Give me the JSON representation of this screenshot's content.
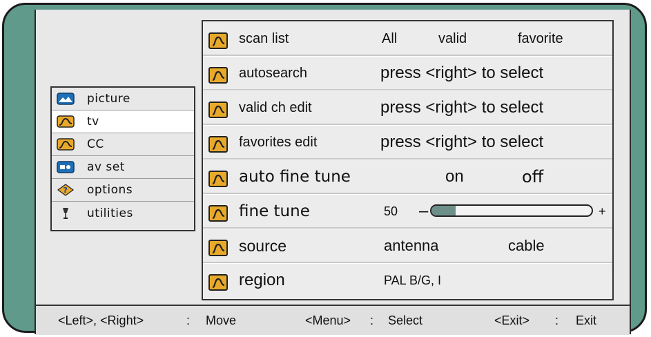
{
  "side_menu": {
    "items": [
      {
        "label": "picture",
        "icon": "picture-icon"
      },
      {
        "label": "tv",
        "icon": "tv-icon",
        "selected": true
      },
      {
        "label": "CC",
        "icon": "cc-icon"
      },
      {
        "label": "av set",
        "icon": "av-set-icon"
      },
      {
        "label": "options",
        "icon": "options-icon"
      },
      {
        "label": "utilities",
        "icon": "utilities-icon"
      }
    ]
  },
  "rows": {
    "scan_list": {
      "label": "scan list",
      "options": [
        "All",
        "valid",
        "favorite"
      ]
    },
    "autosearch": {
      "label": "autosearch",
      "value": "press <right> to select"
    },
    "valid_ch_edit": {
      "label": "valid ch edit",
      "value": "press <right> to select"
    },
    "favorites_edit": {
      "label": "favorites edit",
      "value": "press <right> to select"
    },
    "auto_fine_tune": {
      "label": "auto fine tune",
      "options": [
        "on",
        "off"
      ]
    },
    "fine_tune": {
      "label": "fine tune",
      "value": "50",
      "minus": "–",
      "plus": "+",
      "level_fraction": 0.15
    },
    "source": {
      "label": "source",
      "options": [
        "antenna",
        "cable"
      ]
    },
    "region": {
      "label": "region",
      "value": "PAL B/G, I"
    }
  },
  "footer": {
    "move_keys": "<Left>, <Right>",
    "sep1": ":",
    "move_label": "Move",
    "menu_key": "<Menu>",
    "sep2": ":",
    "select_label": "Select",
    "exit_key": "<Exit>",
    "sep3": ":",
    "exit_label": "Exit"
  },
  "colors": {
    "bezel": "#5f9a8a",
    "icon_folder": "#e8a92a",
    "icon_wave": "#1a1a1a",
    "selected_bg": "#ffffff"
  }
}
